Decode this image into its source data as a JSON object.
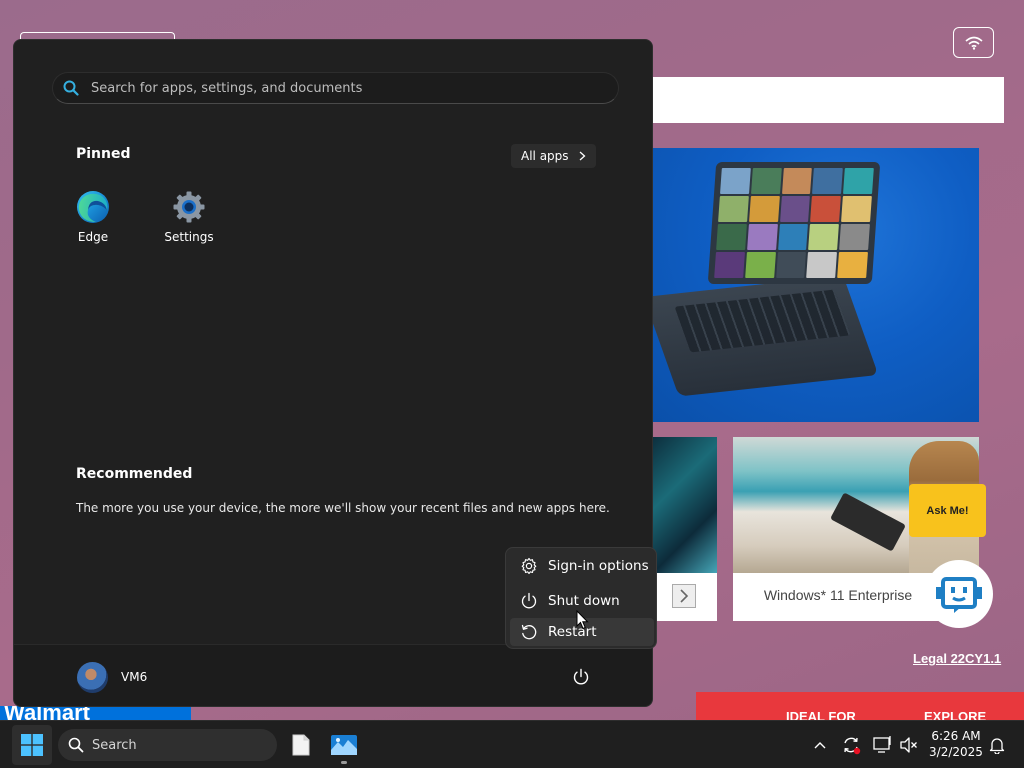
{
  "background_page": {
    "card_caption": "Windows* 11 Enterprise",
    "ask_me_label": "Ask Me!",
    "legal_link": "Legal 22CY1.1",
    "walmart_text": "Walmart",
    "promo_left": "IDEAL FOR",
    "promo_right": "EXPLORE"
  },
  "start_menu": {
    "search_placeholder": "Search for apps, settings, and documents",
    "pinned_title": "Pinned",
    "all_apps_label": "All apps",
    "pinned_apps": [
      {
        "label": "Edge",
        "icon": "edge-icon"
      },
      {
        "label": "Settings",
        "icon": "settings-gear-icon"
      }
    ],
    "recommended_title": "Recommended",
    "recommended_text": "The more you use your device, the more we'll show your recent files and new apps here.",
    "user_name": "VM6"
  },
  "power_menu": {
    "items": [
      {
        "label": "Sign-in options",
        "icon": "gear-icon"
      },
      {
        "label": "Shut down",
        "icon": "power-icon"
      },
      {
        "label": "Restart",
        "icon": "restart-icon"
      }
    ],
    "hovered": "Restart"
  },
  "taskbar": {
    "search_label": "Search",
    "time": "6:26 AM",
    "date": "3/2/2025"
  },
  "colors": {
    "start_bg": "#202020",
    "taskbar_bg": "#1f1f1f",
    "accent_blue": "#0078d4",
    "ask_me_yellow": "#f8c21c"
  }
}
